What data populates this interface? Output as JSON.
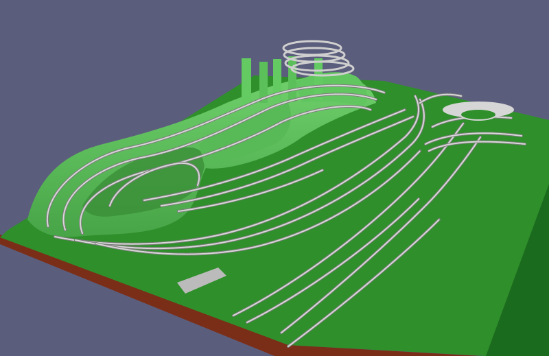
{
  "viewport": {
    "background_color": "#5b5d7c",
    "board_top_color": "#2f8f2b",
    "board_edge_color": "#7b2e17",
    "board_side_color": "#1b6b1e",
    "hill_color": "#6fd06b",
    "hill_shade_color": "#47a447",
    "track_rail_color": "#d8d8d8",
    "track_tie_color": "#7d7d7d"
  },
  "scene": {
    "icons": [
      "layout-board",
      "mountain",
      "helix",
      "track-plan",
      "turntable",
      "yard"
    ]
  }
}
